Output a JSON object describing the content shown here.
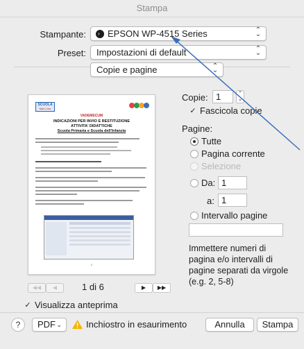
{
  "window": {
    "title": "Stampa"
  },
  "printer": {
    "label": "Stampante:",
    "value": "EPSON WP-4515 Series"
  },
  "preset": {
    "label": "Preset:",
    "value": "Impostazioni di default"
  },
  "section": {
    "value": "Copie e pagine"
  },
  "preview_doc": {
    "logo_text": "SCUOLA",
    "logo_sub": "Mari Lina",
    "heading": "VADEMECUM",
    "title_line1": "INDICAZIONI PER INVIO E RESTITUZIONE",
    "title_line2": "ATTIVITA' DIDATTICHE",
    "title_line3": "Scuola Primaria e Scuola dell'Infanzia",
    "page_number": "1"
  },
  "navigation": {
    "first": "◀◀",
    "prev": "◀",
    "page_label": "1 di 6",
    "next": "▶",
    "last": "▶▶"
  },
  "show_preview": {
    "label": "Visualizza anteprima",
    "checked": true
  },
  "copies": {
    "label": "Copie:",
    "value": "1"
  },
  "collate": {
    "label": "Fascicola copie",
    "checked": true
  },
  "pages": {
    "label": "Pagine:",
    "all": "Tutte",
    "current": "Pagina corrente",
    "selection": "Selezione",
    "from_label": "Da:",
    "from_value": "1",
    "to_label": "a:",
    "to_value": "1",
    "range_label": "Intervallo pagine",
    "range_value": "",
    "help": "Immettere numeri di pagina e/o intervalli di pagine separati da virgole (e.g. 2, 5-8)"
  },
  "footer": {
    "help": "?",
    "pdf": "PDF",
    "warning": "Inchiostro in esaurimento",
    "cancel": "Annulla",
    "print": "Stampa"
  },
  "colors": {
    "arrow": "#3b6fb6",
    "warning": "#f5b400",
    "doc_red": "#c0272d",
    "doc_green": "#2e9b4a"
  }
}
